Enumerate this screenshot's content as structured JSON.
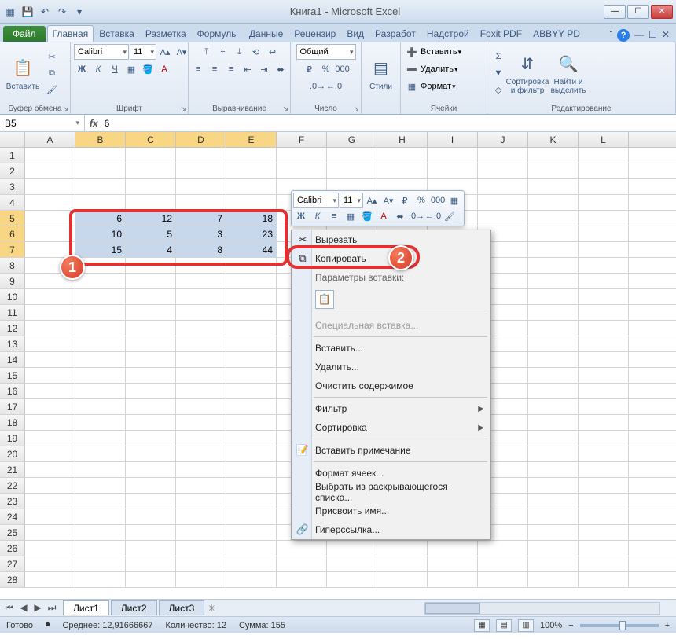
{
  "title": "Книга1 - Microsoft Excel",
  "window": {
    "min": "—",
    "max": "☐",
    "close": "✕"
  },
  "tabs": {
    "file": "Файл",
    "items": [
      "Главная",
      "Вставка",
      "Разметка",
      "Формулы",
      "Данные",
      "Рецензир",
      "Вид",
      "Разработ",
      "Надстрой",
      "Foxit PDF",
      "ABBYY PD"
    ],
    "active": 0
  },
  "ribbon": {
    "clipboard": {
      "paste": "Вставить",
      "label": "Буфер обмена"
    },
    "font": {
      "name": "Calibri",
      "size": "11",
      "bold": "Ж",
      "italic": "К",
      "underline": "Ч",
      "label": "Шрифт"
    },
    "align": {
      "label": "Выравнивание"
    },
    "number": {
      "format": "Общий",
      "label": "Число"
    },
    "styles": {
      "btn": "Стили"
    },
    "cells": {
      "insert": "Вставить",
      "delete": "Удалить",
      "format": "Формат",
      "label": "Ячейки"
    },
    "editing": {
      "sort": "Сортировка и фильтр",
      "find": "Найти и выделить",
      "label": "Редактирование"
    }
  },
  "namebox": "B5",
  "formula": "6",
  "columns": [
    "A",
    "B",
    "C",
    "D",
    "E",
    "F",
    "G",
    "H",
    "I",
    "J",
    "K",
    "L"
  ],
  "rowcount": 28,
  "selection": {
    "r1": 5,
    "c1": 1,
    "r2": 7,
    "c2": 4
  },
  "cells": {
    "5": {
      "B": "6",
      "C": "12",
      "D": "7",
      "E": "18"
    },
    "6": {
      "B": "10",
      "C": "5",
      "D": "3",
      "E": "23"
    },
    "7": {
      "B": "15",
      "C": "4",
      "D": "8",
      "E": "44"
    }
  },
  "minibar": {
    "font": "Calibri",
    "size": "11"
  },
  "context": {
    "cut": "Вырезать",
    "copy": "Копировать",
    "pasteopts": "Параметры вставки:",
    "pastespecial": "Специальная вставка...",
    "insert": "Вставить...",
    "delete": "Удалить...",
    "clear": "Очистить содержимое",
    "filter": "Фильтр",
    "sort": "Сортировка",
    "comment": "Вставить примечание",
    "format": "Формат ячеек...",
    "dropdown": "Выбрать из раскрывающегося списка...",
    "name": "Присвоить имя...",
    "hyperlink": "Гиперссылка..."
  },
  "sheets": [
    "Лист1",
    "Лист2",
    "Лист3"
  ],
  "status": {
    "ready": "Готово",
    "avg_label": "Среднее:",
    "avg": "12,91666667",
    "count_label": "Количество:",
    "count": "12",
    "sum_label": "Сумма:",
    "sum": "155",
    "zoom": "100%"
  },
  "callouts": {
    "one": "1",
    "two": "2"
  }
}
